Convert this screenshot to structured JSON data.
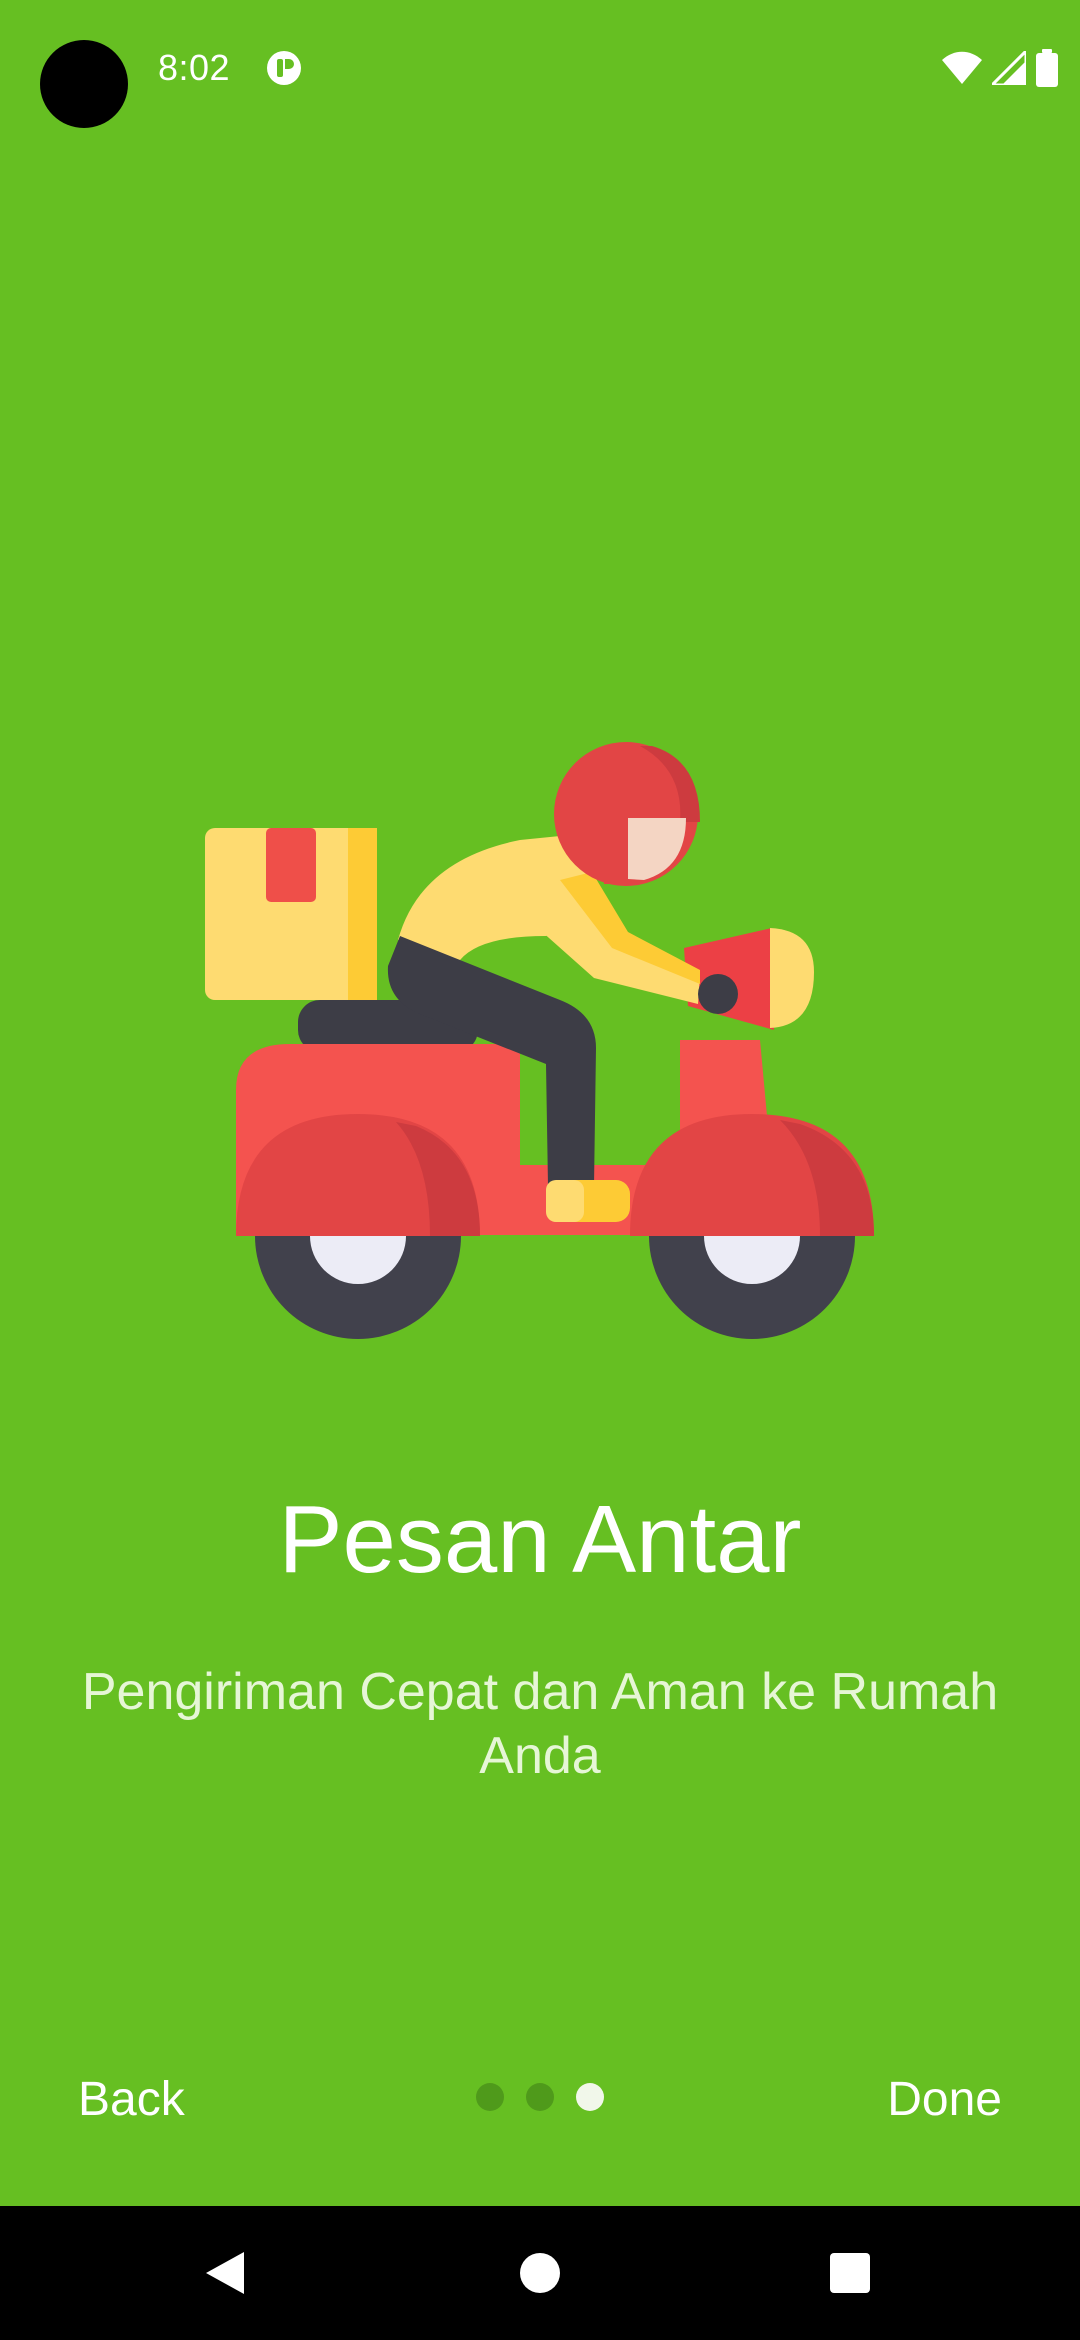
{
  "status_bar": {
    "time": "8:02",
    "app_icon": "app-notification-icon",
    "wifi_icon": "wifi-icon",
    "signal_icon": "cell-signal-icon",
    "battery_icon": "battery-icon"
  },
  "illustration": {
    "icon": "delivery-scooter-illustration"
  },
  "slide": {
    "title": "Pesan Antar",
    "description": "Pengiriman Cepat dan Aman ke Rumah Anda"
  },
  "footer": {
    "back_label": "Back",
    "done_label": "Done",
    "page_count": 3,
    "active_page": 3
  },
  "nav_bar": {
    "back_icon": "back-triangle-icon",
    "home_icon": "home-circle-icon",
    "recents_icon": "recents-square-icon"
  },
  "colors": {
    "background": "#66bf22",
    "text": "#ffffff",
    "description_text": "#e6f6d6",
    "dot_inactive": "#4f9a1b",
    "dot_active": "#f1f7ea"
  }
}
